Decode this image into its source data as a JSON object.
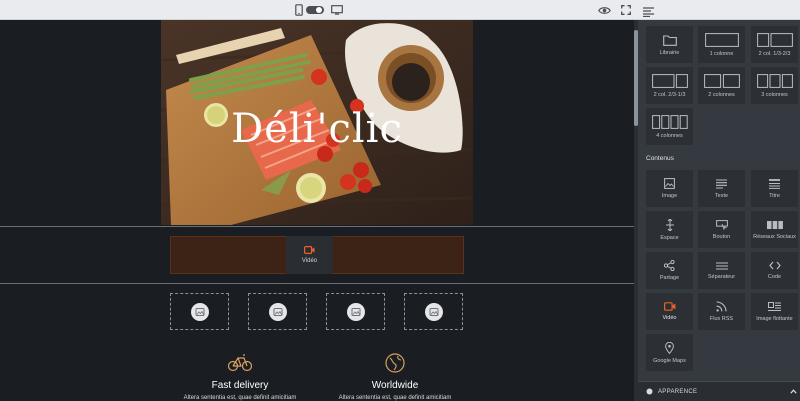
{
  "toolbar": {
    "icons": [
      "mobile-icon",
      "toggle-switch",
      "desktop-icon",
      "eye-icon",
      "fullscreen-icon",
      "panel-menu-icon"
    ]
  },
  "hero": {
    "title": "Déli'clic"
  },
  "video_block": {
    "label": "Vidéo",
    "accent_color": "#e8622a"
  },
  "image_placeholders": [
    "image-placeholder",
    "image-placeholder",
    "image-placeholder",
    "image-placeholder"
  ],
  "features": [
    {
      "icon": "bicycle-icon",
      "title": "Fast delivery",
      "text": "Altera sententia est, quae definit amicitiam"
    },
    {
      "icon": "globe-icon",
      "title": "Worldwide",
      "text": "Altera sententia est, quae definit amicitiam"
    }
  ],
  "panel": {
    "layouts": [
      {
        "label": "Librairie",
        "icon": "folder-icon"
      },
      {
        "label": "1 colonne",
        "icon": "one-column-icon"
      },
      {
        "label": "2 col. 1/3-2/3",
        "icon": "two-col-1-3-icon"
      },
      {
        "label": "2 col. 2/3-1/3",
        "icon": "two-col-2-3-icon"
      },
      {
        "label": "2 colonnes",
        "icon": "two-columns-icon"
      },
      {
        "label": "3 colonnes",
        "icon": "three-columns-icon"
      },
      {
        "label": "4 colonnes",
        "icon": "four-columns-icon"
      }
    ],
    "content_title": "Contenus",
    "contents": [
      {
        "label": "Image",
        "icon": "image-icon"
      },
      {
        "label": "Texte",
        "icon": "text-icon"
      },
      {
        "label": "Titre",
        "icon": "title-icon"
      },
      {
        "label": "Espace",
        "icon": "spacer-icon"
      },
      {
        "label": "Bouton",
        "icon": "button-icon"
      },
      {
        "label": "Réseaux Sociaux",
        "icon": "social-icon"
      },
      {
        "label": "Partage",
        "icon": "share-icon"
      },
      {
        "label": "Séparateur",
        "icon": "separator-icon"
      },
      {
        "label": "Code",
        "icon": "code-icon"
      },
      {
        "label": "Vidéo",
        "icon": "video-icon"
      },
      {
        "label": "Flux RSS",
        "icon": "rss-icon"
      },
      {
        "label": "Image flottante",
        "icon": "floating-image-icon"
      },
      {
        "label": "Google Maps",
        "icon": "map-pin-icon"
      }
    ],
    "appearance_label": "APPARENCE"
  }
}
